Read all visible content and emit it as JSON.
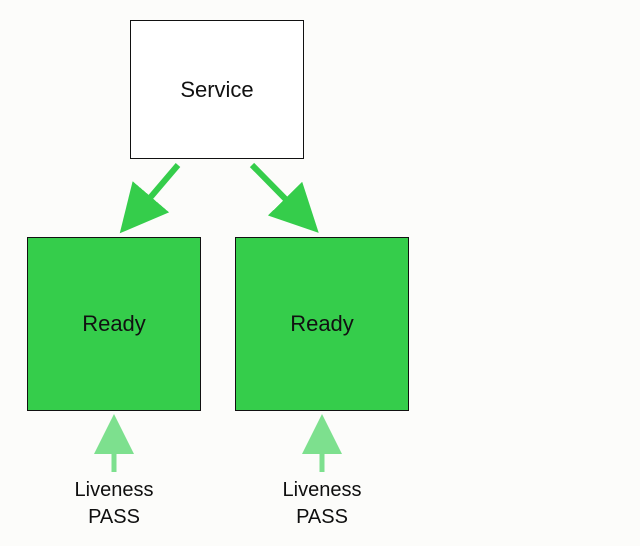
{
  "service": {
    "label": "Service"
  },
  "pods": [
    {
      "state": "Ready",
      "liveness_label": "Liveness",
      "liveness_status": "PASS"
    },
    {
      "state": "Ready",
      "liveness_label": "Liveness",
      "liveness_status": "PASS"
    }
  ],
  "colors": {
    "healthy": "#35cd4b",
    "arrow_service": "#35cd4b",
    "arrow_liveness": "#7de08e"
  }
}
